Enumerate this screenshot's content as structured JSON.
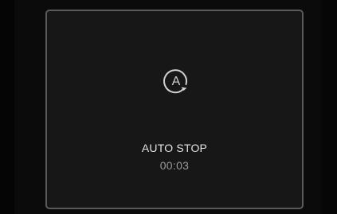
{
  "display": {
    "icon": "auto-stop-icon",
    "icon_letter": "A",
    "status_label": "AUTO STOP",
    "timer": "00:03"
  },
  "colors": {
    "background": "#0b0b0b",
    "panel": "#171717",
    "panel_border": "#5a5a5a",
    "label_text": "#e2e2e2",
    "timer_text": "#9a9a9a",
    "icon": "#d0d0d0"
  }
}
